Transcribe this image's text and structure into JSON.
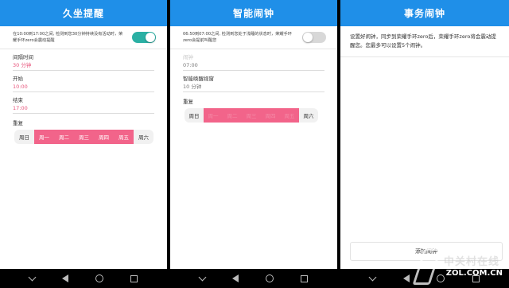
{
  "screen1": {
    "title": "久坐提醒",
    "toggle_desc": "在10:00到17:00之间, 检测到您30分钟持续没有活动时，荣耀手环zero会震动提醒",
    "toggle_on": true,
    "fields": [
      {
        "label": "间隔时间",
        "value": "30 分钟"
      },
      {
        "label": "开始",
        "value": "10:00"
      },
      {
        "label": "结束",
        "value": "17:00"
      }
    ],
    "repeat_label": "重复",
    "days": [
      {
        "label": "周日",
        "selected": false
      },
      {
        "label": "周一",
        "selected": true
      },
      {
        "label": "周二",
        "selected": true
      },
      {
        "label": "周三",
        "selected": true
      },
      {
        "label": "周四",
        "selected": true
      },
      {
        "label": "周五",
        "selected": true
      },
      {
        "label": "周六",
        "selected": false
      }
    ]
  },
  "screen2": {
    "title": "智能闹钟",
    "toggle_desc": "06:50到07:00之间, 检测到您处于浅睡的状态时，荣耀手环zero会提前叫醒您",
    "toggle_on": false,
    "field1": {
      "label": "闹钟",
      "value": "07:00"
    },
    "field2": {
      "label": "智能唤醒视窗",
      "value": "10 分钟"
    },
    "repeat_label": "重复",
    "days": [
      {
        "label": "周日",
        "selected": false
      },
      {
        "label": "周一",
        "selected": true
      },
      {
        "label": "周二",
        "selected": true
      },
      {
        "label": "周三",
        "selected": true
      },
      {
        "label": "周四",
        "selected": true
      },
      {
        "label": "周五",
        "selected": true
      },
      {
        "label": "周六",
        "selected": false
      }
    ]
  },
  "screen3": {
    "title": "事务闹钟",
    "info": "设置好闹钟，同步到荣耀手环zero后，荣耀手环zero将会震动提醒您。您最多可以设置5个闹钟。",
    "add_button": "添加闹钟"
  },
  "watermark": {
    "cn": "中关村在线",
    "site": "ZOL.COM.CN"
  },
  "colors": {
    "appbar": "#1f8fe8",
    "accent_pink": "#f2648a",
    "toggle_on": "#2bb0a4"
  }
}
